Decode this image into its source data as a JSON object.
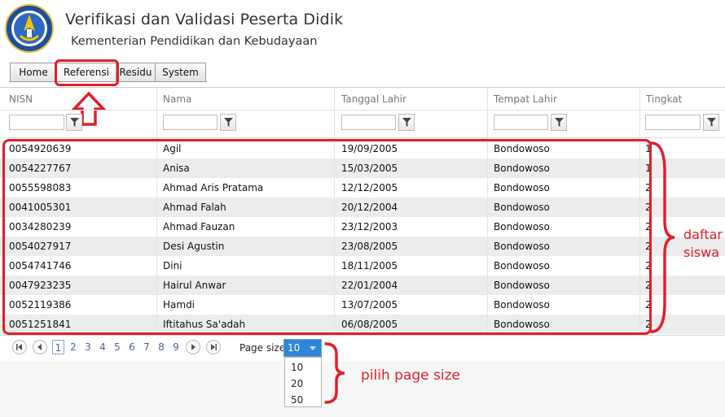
{
  "header": {
    "title": "Verifikasi dan Validasi Peserta Didik",
    "subtitle": "Kementerian Pendidikan dan Kebudayaan"
  },
  "menu": [
    "Home",
    "Referensi",
    "Residu",
    "System"
  ],
  "columns": [
    "NISN",
    "Nama",
    "Tanggal Lahir",
    "Tempat Lahir",
    "Tingkat"
  ],
  "rows": [
    [
      "0054920639",
      "Agil",
      "19/09/2005",
      "Bondowoso",
      "1"
    ],
    [
      "0054227767",
      "Anisa",
      "15/03/2005",
      "Bondowoso",
      "1"
    ],
    [
      "0055598083",
      "Ahmad Aris Pratama",
      "12/12/2005",
      "Bondowoso",
      "2"
    ],
    [
      "0041005301",
      "Ahmad Falah",
      "20/12/2004",
      "Bondowoso",
      "2"
    ],
    [
      "0034280239",
      "Ahmad Fauzan",
      "23/12/2003",
      "Bondowoso",
      "2"
    ],
    [
      "0054027917",
      "Desi Agustin",
      "23/08/2005",
      "Bondowoso",
      "2"
    ],
    [
      "0054741746",
      "Dini",
      "18/11/2005",
      "Bondowoso",
      "2"
    ],
    [
      "0047923235",
      "Hairul Anwar",
      "22/01/2004",
      "Bondowoso",
      "2"
    ],
    [
      "0052119386",
      "Hamdi",
      "13/07/2005",
      "Bondowoso",
      "2"
    ],
    [
      "0051251841",
      "Iftitahus Sa'adah",
      "06/08/2005",
      "Bondowoso",
      "2"
    ]
  ],
  "pager": {
    "pages": [
      "1",
      "2",
      "3",
      "4",
      "5",
      "6",
      "7",
      "8",
      "9"
    ],
    "current": "1",
    "page_size_label": "Page size:",
    "page_size_value": "10",
    "page_size_options": [
      "10",
      "20",
      "50"
    ]
  },
  "annotations": {
    "list_label_line1": "daftar",
    "list_label_line2": "siswa",
    "pagesize_label": "pilih page size"
  },
  "colors": {
    "annotation": "#e0202a",
    "selection": "#2f86d8",
    "row_alt": "#ececec"
  }
}
